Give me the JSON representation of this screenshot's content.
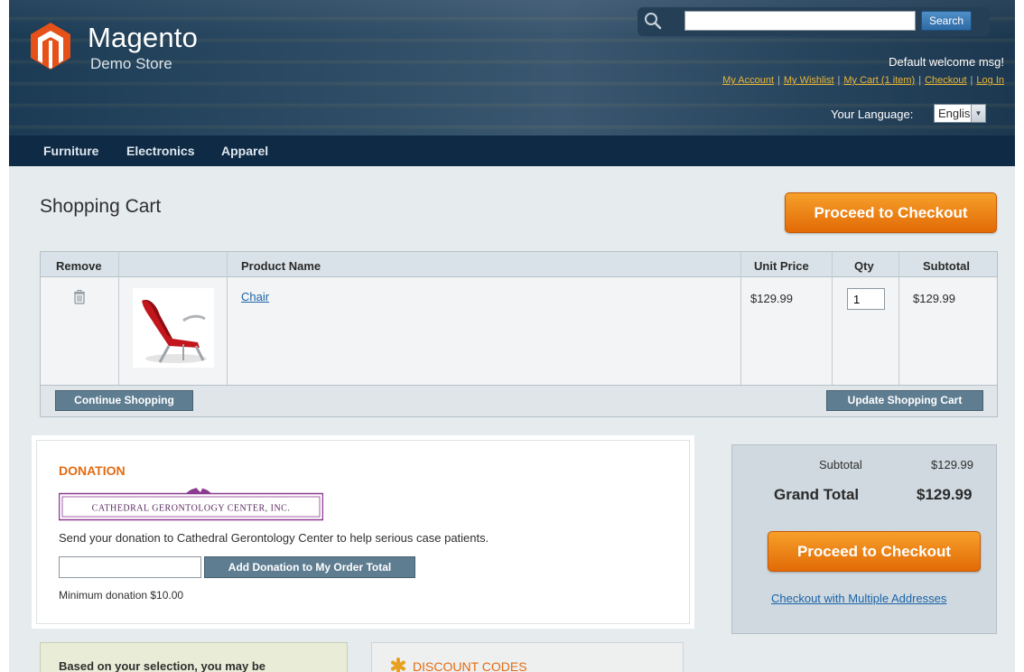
{
  "header": {
    "brand": "Magento",
    "brand_sub": "Demo Store",
    "search": {
      "placeholder": "",
      "button_label": "Search"
    },
    "welcome": "Default welcome msg!",
    "links": [
      "My Account",
      "My Wishlist",
      "My Cart (1 item)",
      "Checkout",
      "Log In"
    ],
    "language_label": "Your Language:",
    "language_value": "English"
  },
  "nav": {
    "items": [
      "Furniture",
      "Electronics",
      "Apparel"
    ]
  },
  "cart": {
    "title": "Shopping Cart",
    "checkout_label": "Proceed to Checkout",
    "columns": [
      "Remove",
      "Product Name",
      "Unit Price",
      "Qty",
      "Subtotal"
    ],
    "items": [
      {
        "name": "Chair",
        "unit_price": "$129.99",
        "qty": "1",
        "subtotal": "$129.99"
      }
    ],
    "continue_label": "Continue Shopping",
    "update_label": "Update Shopping Cart"
  },
  "donation": {
    "title": "DONATION",
    "org_logo_text": "CATHEDRAL GERONTOLOGY CENTER, INC.",
    "description": "Send your donation to Cathedral Gerontology Center to help serious case patients.",
    "button_label": "Add Donation to My Order Total",
    "minimum": "Minimum donation $10.00"
  },
  "totals": {
    "subtotal_label": "Subtotal",
    "subtotal_value": "$129.99",
    "grand_label": "Grand Total",
    "grand_value": "$129.99",
    "checkout_label": "Proceed to Checkout",
    "multi_label": "Checkout with Multiple Addresses"
  },
  "crosssell": {
    "title": "Based on your selection, you may be"
  },
  "discount": {
    "title": "DISCOUNT CODES"
  },
  "colors": {
    "accent_orange": "#e46b12",
    "header_bg": "#1b3b55",
    "nav_bg": "#0e2a45",
    "link_blue": "#1b63a8",
    "button_grey": "#5f7d91"
  }
}
